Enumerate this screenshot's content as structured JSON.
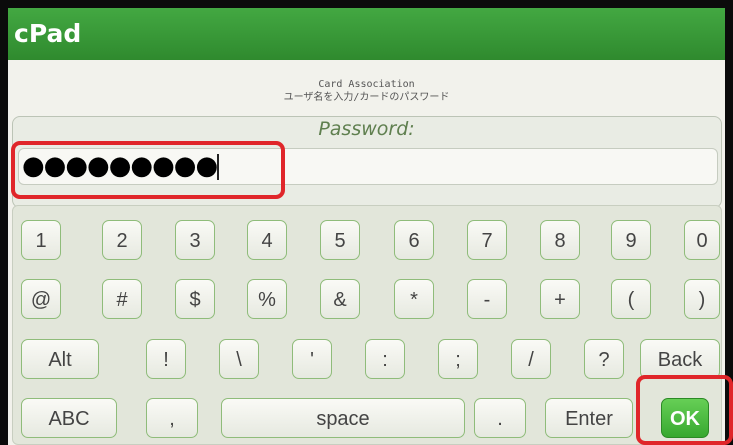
{
  "app": {
    "title": "cPad"
  },
  "header": {
    "line1": "Card Association",
    "line2": "ユーザ名を入力/カードのパスワード"
  },
  "password": {
    "label": "Password:",
    "value": "●●●●●●●●●"
  },
  "keyboard": {
    "row1": [
      "1",
      "2",
      "3",
      "4",
      "5",
      "6",
      "7",
      "8",
      "9",
      "0"
    ],
    "row2": [
      "@",
      "#",
      "$",
      "%",
      "&",
      "*",
      "-",
      "+",
      "(",
      ")"
    ],
    "row3": [
      "Alt",
      "!",
      "\\",
      "'",
      ":",
      ";",
      "/",
      "?",
      "Back"
    ],
    "row4": [
      "ABC",
      ",",
      "space",
      ".",
      "Enter",
      "OK"
    ]
  },
  "colors": {
    "titlebar": "#2f8a2e",
    "accent_green": "#43a842",
    "ok_key": "#37a82f",
    "highlight": "#e0262a"
  }
}
